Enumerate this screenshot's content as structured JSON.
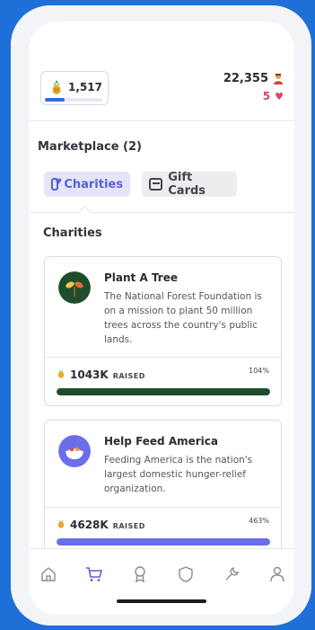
{
  "header": {
    "points": "1,517",
    "points_progress": 0.35,
    "score": "22,355",
    "lives": "5"
  },
  "marketplace": {
    "title": "Marketplace (2)",
    "tabs": [
      {
        "label": "Charities",
        "icon": "heart-tag-icon",
        "active": true
      },
      {
        "label": "Gift Cards",
        "icon": "gift-card-icon",
        "active": false
      }
    ],
    "section_title": "Charities"
  },
  "charities": [
    {
      "name": "Plant A Tree",
      "description": "The National Forest Foundation is on a mission to plant 50 million trees across the country's public lands.",
      "raised_amount": "1043K",
      "raised_label": "RAISED",
      "percent": "104%",
      "progress": 1.0,
      "bar_color": "#1e4d2b",
      "logo_bg": "#1e4d2b"
    },
    {
      "name": "Help Feed America",
      "description": "Feeding America is the nation's largest domestic hunger-relief organization.",
      "raised_amount": "4628K",
      "raised_label": "RAISED",
      "percent": "463%",
      "progress": 1.0,
      "bar_color": "#6a6ee8",
      "logo_bg": "#6a6ee8"
    }
  ],
  "nav": [
    {
      "name": "home-icon",
      "active": false
    },
    {
      "name": "cart-icon",
      "active": true
    },
    {
      "name": "badge-icon",
      "active": false
    },
    {
      "name": "shield-icon",
      "active": false
    },
    {
      "name": "wrench-icon",
      "active": false
    },
    {
      "name": "profile-icon",
      "active": false
    }
  ],
  "colors": {
    "accent": "#5a5fd6",
    "background": "#1f6fd8",
    "heart": "#e0435c"
  }
}
